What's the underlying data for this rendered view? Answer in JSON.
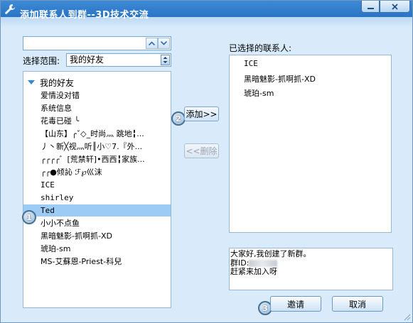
{
  "window": {
    "title": "添加联系人到群--3D技术交流",
    "minimize_icon": "minimize-icon",
    "close_icon": "close-icon"
  },
  "search": {
    "value": "",
    "placeholder": ""
  },
  "scope": {
    "label": "选择范围:",
    "selected": "我的好友"
  },
  "tree": {
    "group": "我的好友",
    "items": [
      {
        "label": "爱情没对错"
      },
      {
        "label": "系统信息"
      },
      {
        "label": "花毒已碰 ╰"
      },
      {
        "label": "【山东】╭ˇ◇_时尚灬 跳地╏..."
      },
      {
        "label": "丿丶新╳视灬听║小♡7.『外..."
      },
      {
        "label": "╭╭╭╭゛[荒禁轩]•西西╏家族..."
      },
      {
        "label": "╭╭●倾訫 ℱ℘巛沫"
      },
      {
        "label": "ICE"
      },
      {
        "label": "shirley"
      },
      {
        "label": "Ted",
        "selected": true
      },
      {
        "label": "小小不点鱼"
      },
      {
        "label": "黑暗魅影-抓啊抓-XD"
      },
      {
        "label": "琥珀-sm"
      },
      {
        "label": "MS-艾蘇恩-Priest-科兒"
      }
    ]
  },
  "steps": {
    "one": "1",
    "two": "2",
    "three": "3"
  },
  "buttons": {
    "add": "添加>>",
    "delete": "<<删除",
    "invite": "邀请",
    "cancel": "取消"
  },
  "selected_panel": {
    "label": "已选择的联系人:",
    "items": [
      "ICE",
      "黑暗魅影-抓啊抓-XD",
      "琥珀-sm"
    ]
  },
  "message": {
    "line1": "大家好,我创建了新群。",
    "line2_prefix": "群ID:",
    "line3": "赶紧来加入呀"
  },
  "colors": {
    "title_bar": "#2a74c4",
    "selection": "#9ccbf6",
    "window_bg": "#d9ebfa"
  }
}
